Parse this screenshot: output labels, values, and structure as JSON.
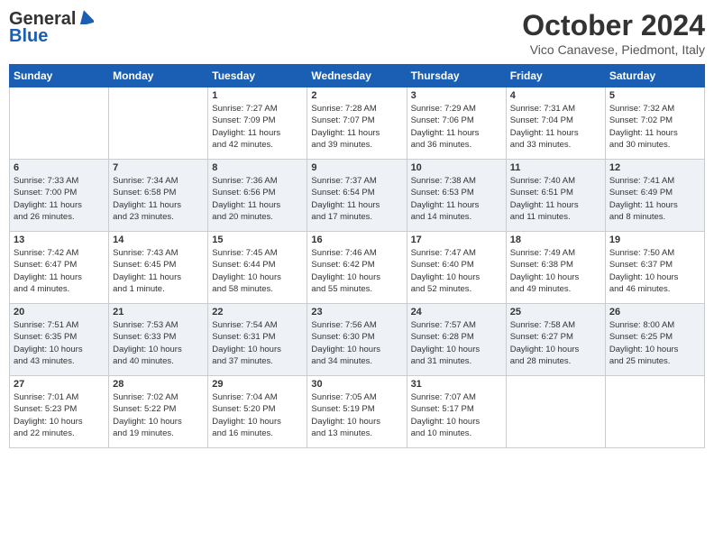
{
  "header": {
    "logo_general": "General",
    "logo_blue": "Blue",
    "month_title": "October 2024",
    "location": "Vico Canavese, Piedmont, Italy"
  },
  "columns": [
    "Sunday",
    "Monday",
    "Tuesday",
    "Wednesday",
    "Thursday",
    "Friday",
    "Saturday"
  ],
  "weeks": [
    {
      "days": [
        {
          "num": "",
          "info": ""
        },
        {
          "num": "",
          "info": ""
        },
        {
          "num": "1",
          "info": "Sunrise: 7:27 AM\nSunset: 7:09 PM\nDaylight: 11 hours\nand 42 minutes."
        },
        {
          "num": "2",
          "info": "Sunrise: 7:28 AM\nSunset: 7:07 PM\nDaylight: 11 hours\nand 39 minutes."
        },
        {
          "num": "3",
          "info": "Sunrise: 7:29 AM\nSunset: 7:06 PM\nDaylight: 11 hours\nand 36 minutes."
        },
        {
          "num": "4",
          "info": "Sunrise: 7:31 AM\nSunset: 7:04 PM\nDaylight: 11 hours\nand 33 minutes."
        },
        {
          "num": "5",
          "info": "Sunrise: 7:32 AM\nSunset: 7:02 PM\nDaylight: 11 hours\nand 30 minutes."
        }
      ]
    },
    {
      "days": [
        {
          "num": "6",
          "info": "Sunrise: 7:33 AM\nSunset: 7:00 PM\nDaylight: 11 hours\nand 26 minutes."
        },
        {
          "num": "7",
          "info": "Sunrise: 7:34 AM\nSunset: 6:58 PM\nDaylight: 11 hours\nand 23 minutes."
        },
        {
          "num": "8",
          "info": "Sunrise: 7:36 AM\nSunset: 6:56 PM\nDaylight: 11 hours\nand 20 minutes."
        },
        {
          "num": "9",
          "info": "Sunrise: 7:37 AM\nSunset: 6:54 PM\nDaylight: 11 hours\nand 17 minutes."
        },
        {
          "num": "10",
          "info": "Sunrise: 7:38 AM\nSunset: 6:53 PM\nDaylight: 11 hours\nand 14 minutes."
        },
        {
          "num": "11",
          "info": "Sunrise: 7:40 AM\nSunset: 6:51 PM\nDaylight: 11 hours\nand 11 minutes."
        },
        {
          "num": "12",
          "info": "Sunrise: 7:41 AM\nSunset: 6:49 PM\nDaylight: 11 hours\nand 8 minutes."
        }
      ]
    },
    {
      "days": [
        {
          "num": "13",
          "info": "Sunrise: 7:42 AM\nSunset: 6:47 PM\nDaylight: 11 hours\nand 4 minutes."
        },
        {
          "num": "14",
          "info": "Sunrise: 7:43 AM\nSunset: 6:45 PM\nDaylight: 11 hours\nand 1 minute."
        },
        {
          "num": "15",
          "info": "Sunrise: 7:45 AM\nSunset: 6:44 PM\nDaylight: 10 hours\nand 58 minutes."
        },
        {
          "num": "16",
          "info": "Sunrise: 7:46 AM\nSunset: 6:42 PM\nDaylight: 10 hours\nand 55 minutes."
        },
        {
          "num": "17",
          "info": "Sunrise: 7:47 AM\nSunset: 6:40 PM\nDaylight: 10 hours\nand 52 minutes."
        },
        {
          "num": "18",
          "info": "Sunrise: 7:49 AM\nSunset: 6:38 PM\nDaylight: 10 hours\nand 49 minutes."
        },
        {
          "num": "19",
          "info": "Sunrise: 7:50 AM\nSunset: 6:37 PM\nDaylight: 10 hours\nand 46 minutes."
        }
      ]
    },
    {
      "days": [
        {
          "num": "20",
          "info": "Sunrise: 7:51 AM\nSunset: 6:35 PM\nDaylight: 10 hours\nand 43 minutes."
        },
        {
          "num": "21",
          "info": "Sunrise: 7:53 AM\nSunset: 6:33 PM\nDaylight: 10 hours\nand 40 minutes."
        },
        {
          "num": "22",
          "info": "Sunrise: 7:54 AM\nSunset: 6:31 PM\nDaylight: 10 hours\nand 37 minutes."
        },
        {
          "num": "23",
          "info": "Sunrise: 7:56 AM\nSunset: 6:30 PM\nDaylight: 10 hours\nand 34 minutes."
        },
        {
          "num": "24",
          "info": "Sunrise: 7:57 AM\nSunset: 6:28 PM\nDaylight: 10 hours\nand 31 minutes."
        },
        {
          "num": "25",
          "info": "Sunrise: 7:58 AM\nSunset: 6:27 PM\nDaylight: 10 hours\nand 28 minutes."
        },
        {
          "num": "26",
          "info": "Sunrise: 8:00 AM\nSunset: 6:25 PM\nDaylight: 10 hours\nand 25 minutes."
        }
      ]
    },
    {
      "days": [
        {
          "num": "27",
          "info": "Sunrise: 7:01 AM\nSunset: 5:23 PM\nDaylight: 10 hours\nand 22 minutes."
        },
        {
          "num": "28",
          "info": "Sunrise: 7:02 AM\nSunset: 5:22 PM\nDaylight: 10 hours\nand 19 minutes."
        },
        {
          "num": "29",
          "info": "Sunrise: 7:04 AM\nSunset: 5:20 PM\nDaylight: 10 hours\nand 16 minutes."
        },
        {
          "num": "30",
          "info": "Sunrise: 7:05 AM\nSunset: 5:19 PM\nDaylight: 10 hours\nand 13 minutes."
        },
        {
          "num": "31",
          "info": "Sunrise: 7:07 AM\nSunset: 5:17 PM\nDaylight: 10 hours\nand 10 minutes."
        },
        {
          "num": "",
          "info": ""
        },
        {
          "num": "",
          "info": ""
        }
      ]
    }
  ]
}
